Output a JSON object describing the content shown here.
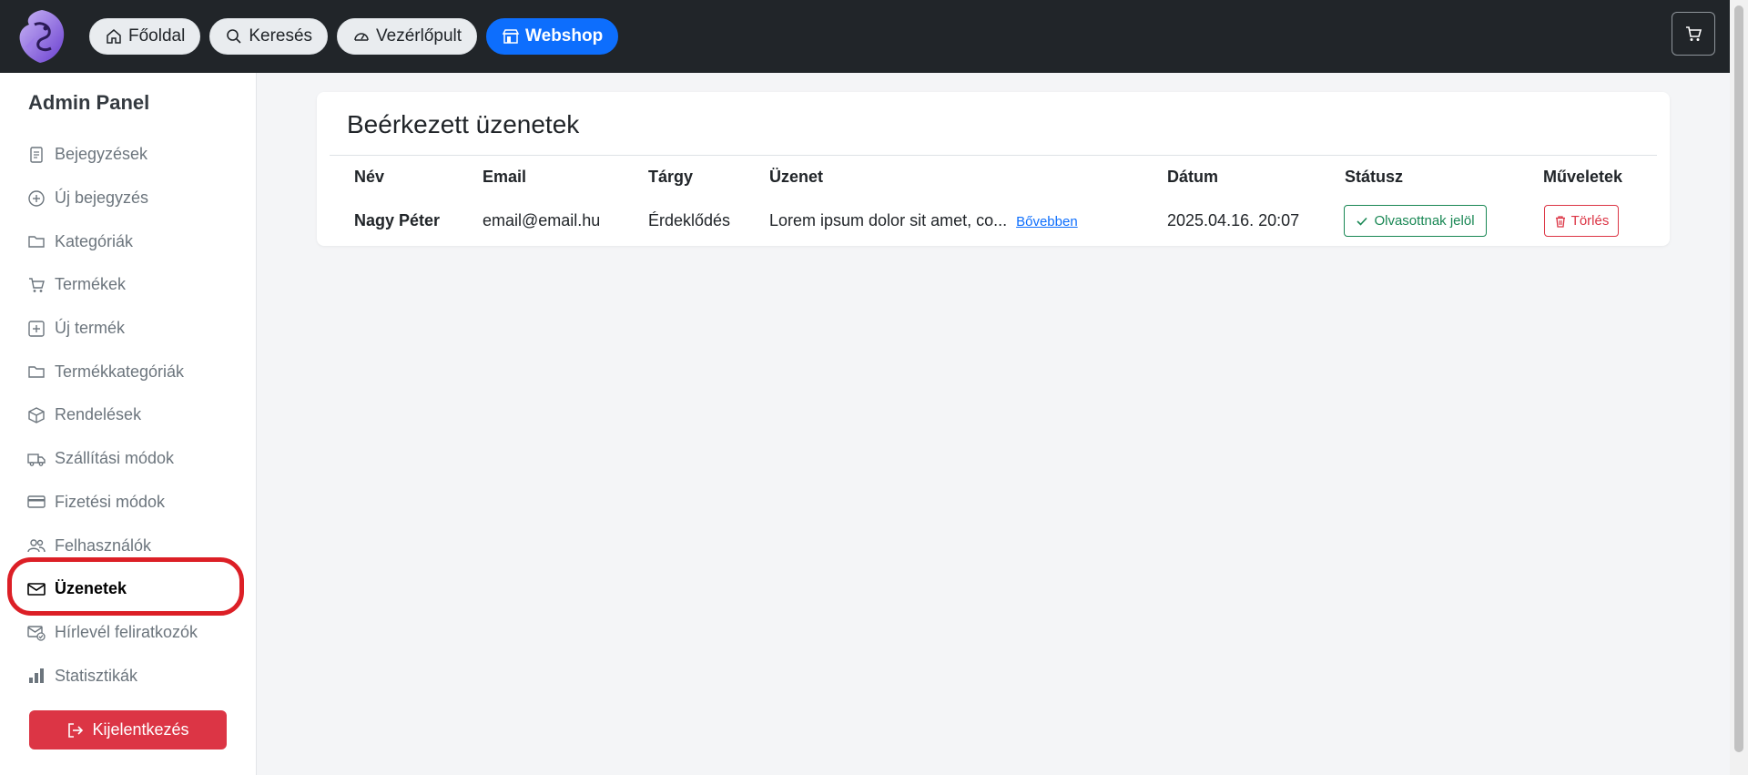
{
  "navbar": {
    "logo_alt": "",
    "items": [
      {
        "label": "Főoldal",
        "icon": "home-icon"
      },
      {
        "label": "Keresés",
        "icon": "search-icon"
      },
      {
        "label": "Vezérlőpult",
        "icon": "speedometer-icon"
      },
      {
        "label": "Webshop",
        "icon": "shop-icon",
        "active": true
      }
    ],
    "cart_icon": "cart-icon"
  },
  "sidebar": {
    "title": "Admin Panel",
    "items": [
      {
        "label": "Bejegyzések",
        "icon": "document-icon"
      },
      {
        "label": "Új bejegyzés",
        "icon": "plus-circle-icon"
      },
      {
        "label": "Kategóriák",
        "icon": "folder-icon"
      },
      {
        "label": "Termékek",
        "icon": "cart-icon"
      },
      {
        "label": "Új termék",
        "icon": "plus-square-icon"
      },
      {
        "label": "Termékkategóriák",
        "icon": "folder-icon"
      },
      {
        "label": "Rendelések",
        "icon": "box-icon"
      },
      {
        "label": "Szállítási módok",
        "icon": "truck-icon"
      },
      {
        "label": "Fizetési módok",
        "icon": "credit-card-icon"
      },
      {
        "label": "Felhasználók",
        "icon": "people-icon"
      },
      {
        "label": "Üzenetek",
        "icon": "envelope-icon",
        "active": true
      },
      {
        "label": "Hírlevél feliratkozók",
        "icon": "envelope-check-icon"
      },
      {
        "label": "Statisztikák",
        "icon": "bar-chart-icon"
      }
    ],
    "logout_label": "Kijelentkezés"
  },
  "main": {
    "title": "Beérkezett üzenetek",
    "columns": [
      "Név",
      "Email",
      "Tárgy",
      "Üzenet",
      "Dátum",
      "Státusz",
      "Műveletek"
    ],
    "rows": [
      {
        "name": "Nagy Péter",
        "email": "email@email.hu",
        "subject": "Érdeklődés",
        "message": "Lorem ipsum dolor sit amet, co...",
        "more_label": "Bővebben",
        "date": "2025.04.16. 20:07",
        "status_button": "Olvasottnak jelöl",
        "delete_button": "Törlés"
      }
    ]
  },
  "colors": {
    "navbar_bg": "#212529",
    "primary": "#0d6efd",
    "danger": "#dc3545",
    "success": "#198754",
    "highlight_ring": "#dc1f26"
  }
}
